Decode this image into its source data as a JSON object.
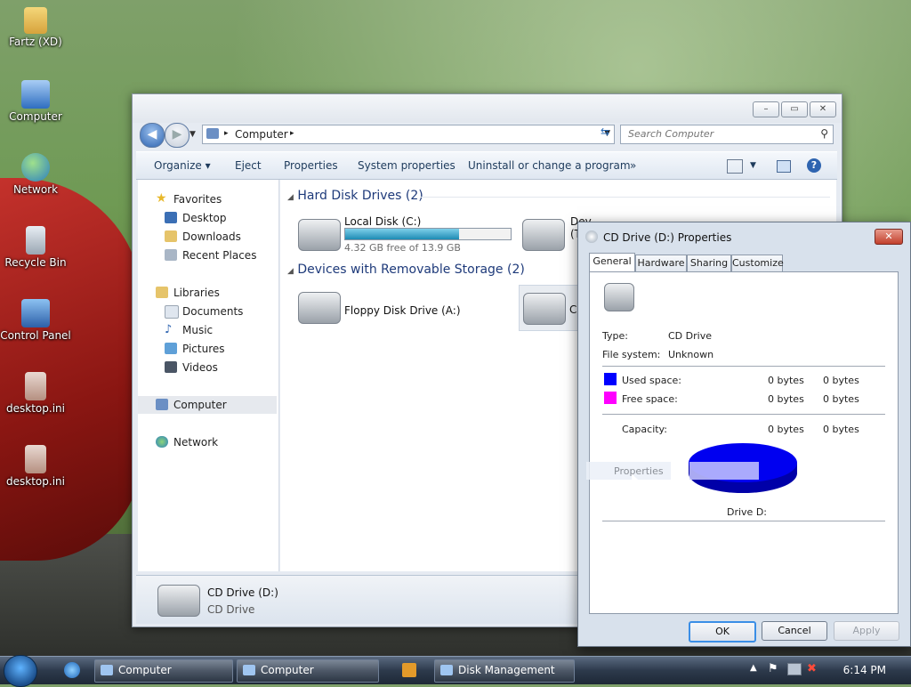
{
  "desktop": {
    "icons": [
      {
        "label": "Fartz (XD)"
      },
      {
        "label": "Computer"
      },
      {
        "label": "Network"
      },
      {
        "label": "Recycle Bin"
      },
      {
        "label": "Control Panel"
      },
      {
        "label": "desktop.ini"
      },
      {
        "label": "desktop.ini"
      }
    ]
  },
  "explorer": {
    "address": {
      "location": "Computer",
      "separator": "▸"
    },
    "search_placeholder": "Search Computer",
    "toolbar": {
      "organize": "Organize ▾",
      "eject": "Eject",
      "properties": "Properties",
      "system_properties": "System properties",
      "uninstall": "Uninstall or change a program",
      "more": "»"
    },
    "nav": {
      "favorites": "Favorites",
      "desktop": "Desktop",
      "downloads": "Downloads",
      "recent_places": "Recent Places",
      "libraries": "Libraries",
      "documents": "Documents",
      "music": "Music",
      "pictures": "Pictures",
      "videos": "Videos",
      "computer": "Computer",
      "network": "Network"
    },
    "groups": {
      "hard_disk": "Hard Disk Drives (2)",
      "removable": "Devices with Removable Storage (2)"
    },
    "drives": {
      "local_disk": {
        "name": "Local Disk (C:)",
        "free": "4.32 GB free of 13.9 GB",
        "used_fraction": 0.69
      },
      "dev": {
        "name": "Dev (T:)"
      },
      "floppy": {
        "name": "Floppy Disk Drive (A:)"
      },
      "cd_partial": {
        "name": "C"
      }
    },
    "details": {
      "name": "CD Drive (D:)",
      "type": "CD Drive"
    }
  },
  "dialog": {
    "title": "CD Drive (D:) Properties",
    "close": "✕",
    "tabs": [
      "General",
      "Hardware",
      "Sharing",
      "Customize"
    ],
    "type_label": "Type:",
    "type_value": "CD Drive",
    "fs_label": "File system:",
    "fs_value": "Unknown",
    "used_label": "Used space:",
    "used_bytes": "0 bytes",
    "used_bytes2": "0 bytes",
    "free_label": "Free space:",
    "free_bytes": "0 bytes",
    "free_bytes2": "0 bytes",
    "capacity_label": "Capacity:",
    "cap_bytes": "0 bytes",
    "cap_bytes2": "0 bytes",
    "drag_ghost": "Properties",
    "drive_label": "Drive D:",
    "ok": "OK",
    "cancel": "Cancel",
    "apply": "Apply",
    "colors": {
      "used": "#0000ff",
      "free": "#ff00ff"
    }
  },
  "taskbar": {
    "items": [
      {
        "label": "Computer"
      },
      {
        "label": "Computer"
      },
      {
        "label": "Disk Management"
      }
    ],
    "time": "6:14 PM"
  }
}
